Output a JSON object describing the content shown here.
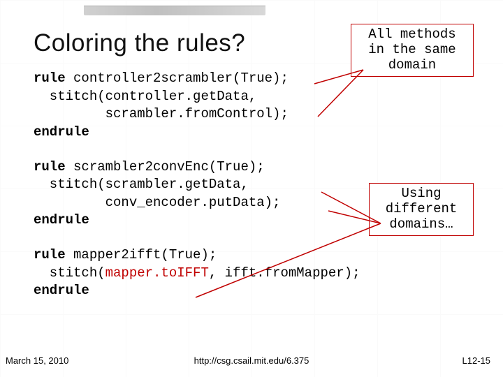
{
  "title": "Coloring the rules?",
  "callouts": {
    "c1": {
      "l1": "All methods",
      "l2": "in the same",
      "l3": "domain"
    },
    "c2": {
      "l1": "Using",
      "l2": "different",
      "l3": "domains…"
    }
  },
  "code": {
    "block1": {
      "kw_rule": "rule",
      "name": " controller2scrambler(True);",
      "l2": "  stitch(controller.getData,",
      "l3": "         scrambler.fromControl);",
      "kw_end": "endrule"
    },
    "block2": {
      "kw_rule": "rule",
      "name": " scrambler2convEnc(True);",
      "l2": "  stitch(scrambler.getData,",
      "l3": "         conv_encoder.putData);",
      "kw_end": "endrule"
    },
    "block3": {
      "kw_rule": "rule",
      "name": " mapper2ifft(True);",
      "l2_a": "  stitch(",
      "l2_b": "mapper.toIFFT",
      "l2_c": ", ifft.fromMapper);",
      "kw_end": "endrule"
    }
  },
  "footer": {
    "left": "March 15, 2010",
    "center": "http://csg.csail.mit.edu/6.375",
    "right": "L12-15"
  }
}
